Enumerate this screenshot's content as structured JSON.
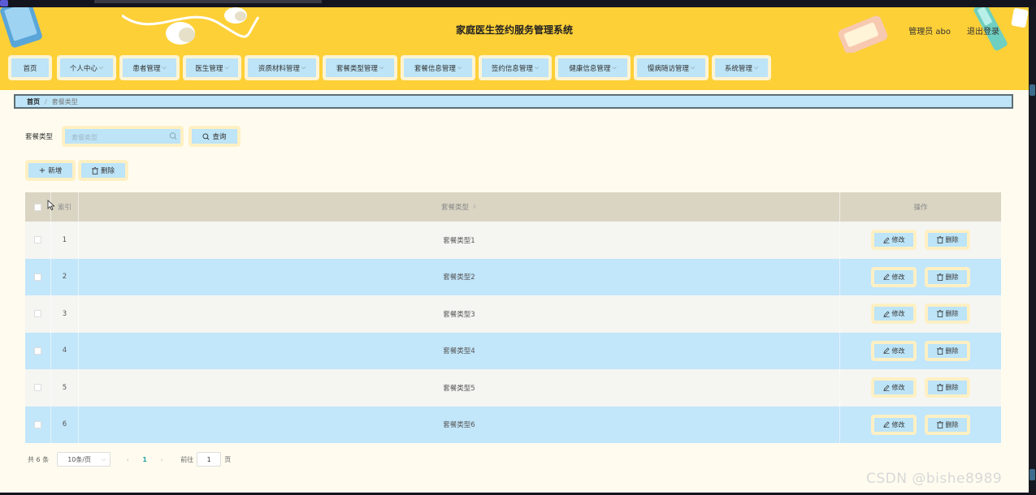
{
  "header": {
    "title": "家庭医生签约服务管理系统",
    "user": "管理员 abo",
    "logout": "退出登录"
  },
  "nav": [
    {
      "label": "首页",
      "dropdown": false
    },
    {
      "label": "个人中心",
      "dropdown": true
    },
    {
      "label": "患者管理",
      "dropdown": true
    },
    {
      "label": "医生管理",
      "dropdown": true
    },
    {
      "label": "资质材料管理",
      "dropdown": true
    },
    {
      "label": "套餐类型管理",
      "dropdown": true
    },
    {
      "label": "套餐信息管理",
      "dropdown": true
    },
    {
      "label": "签约信息管理",
      "dropdown": true
    },
    {
      "label": "健康信息管理",
      "dropdown": true
    },
    {
      "label": "慢病随访管理",
      "dropdown": true
    },
    {
      "label": "系统管理",
      "dropdown": true
    }
  ],
  "breadcrumb": {
    "home": "首页",
    "current": "套餐类型"
  },
  "search": {
    "label": "套餐类型",
    "placeholder": "套餐类型",
    "query_label": "查询"
  },
  "actions": {
    "add_label": "新增",
    "delete_label": "删除"
  },
  "table": {
    "headers": {
      "index": "索引",
      "name": "套餐类型",
      "ops": "操作"
    },
    "rows": [
      {
        "index": "1",
        "name": "套餐类型1"
      },
      {
        "index": "2",
        "name": "套餐类型2"
      },
      {
        "index": "3",
        "name": "套餐类型3"
      },
      {
        "index": "4",
        "name": "套餐类型4"
      },
      {
        "index": "5",
        "name": "套餐类型5"
      },
      {
        "index": "6",
        "name": "套餐类型6"
      }
    ],
    "edit_label": "修改",
    "delete_label": "删除"
  },
  "pagination": {
    "total": "共 6 条",
    "page_size": "10条/页",
    "current_page": "1",
    "goto": "前往",
    "goto_value": "1",
    "page_word": "页"
  },
  "watermark": "CSDN @bishe8989",
  "colors": {
    "header_bg": "#fdd037",
    "button_bg": "#bde4f7",
    "button_border": "#fff0c4",
    "page_bg": "#fffcef",
    "table_header": "#dad5c3",
    "row_alt": "#c2e6fa"
  }
}
